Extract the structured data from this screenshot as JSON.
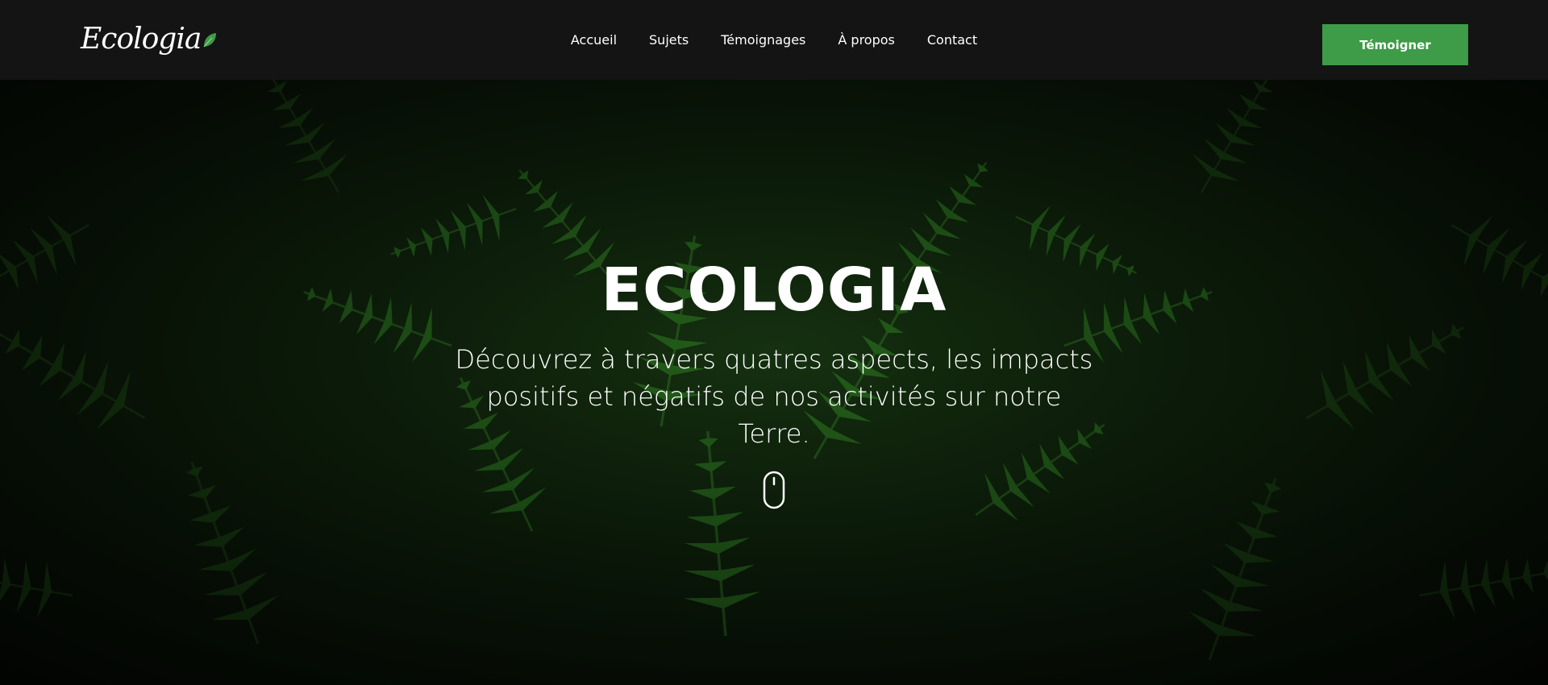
{
  "header": {
    "logo_text": "Ecologia",
    "nav": [
      {
        "label": "Accueil"
      },
      {
        "label": "Sujets"
      },
      {
        "label": "Témoignages"
      },
      {
        "label": "À propos"
      },
      {
        "label": "Contact"
      }
    ],
    "cta_label": "Témoigner"
  },
  "hero": {
    "title": "ECOLOGIA",
    "subtitle": "Découvrez à travers quatres aspects, les impacts positifs et négatifs de nos activités sur notre Terre.",
    "scroll_icon": "mouse-scroll-icon"
  },
  "colors": {
    "nav_background": "#141414",
    "accent": "#3e9b47",
    "text": "#ffffff"
  }
}
